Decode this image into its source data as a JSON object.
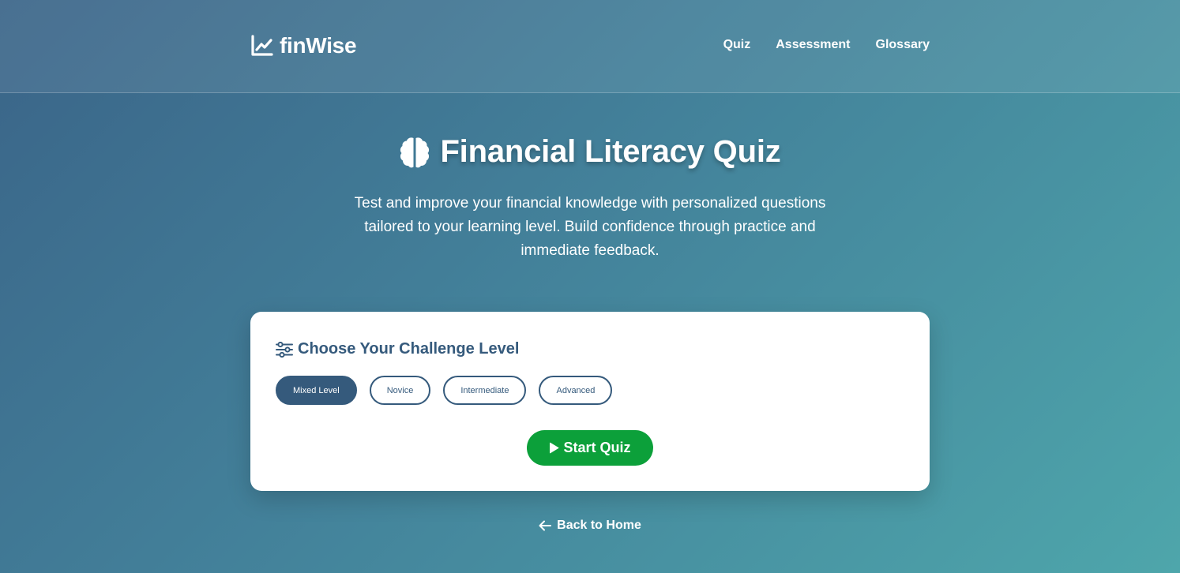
{
  "brand": {
    "name": "finWise",
    "icon": "chart-line-icon"
  },
  "nav": {
    "items": [
      {
        "label": "Quiz"
      },
      {
        "label": "Assessment"
      },
      {
        "label": "Glossary"
      }
    ]
  },
  "hero": {
    "icon": "brain-icon",
    "title": "Financial Literacy Quiz",
    "description": "Test and improve your financial knowledge with personalized questions tailored to your learning level. Build confidence through practice and immediate feedback."
  },
  "card": {
    "icon": "sliders-icon",
    "heading": "Choose Your Challenge Level",
    "levels": [
      {
        "label": "Mixed Level",
        "selected": true
      },
      {
        "label": "Novice",
        "selected": false
      },
      {
        "label": "Intermediate",
        "selected": false
      },
      {
        "label": "Advanced",
        "selected": false
      }
    ],
    "start_label": "Start Quiz",
    "start_icon": "play-icon"
  },
  "back": {
    "label": "Back to Home",
    "icon": "arrow-left-icon"
  },
  "colors": {
    "primary": "#355a7c",
    "success": "#0ca03a",
    "white": "#ffffff",
    "gradient_start": "#3a6488",
    "gradient_end": "#4ea6ab"
  }
}
